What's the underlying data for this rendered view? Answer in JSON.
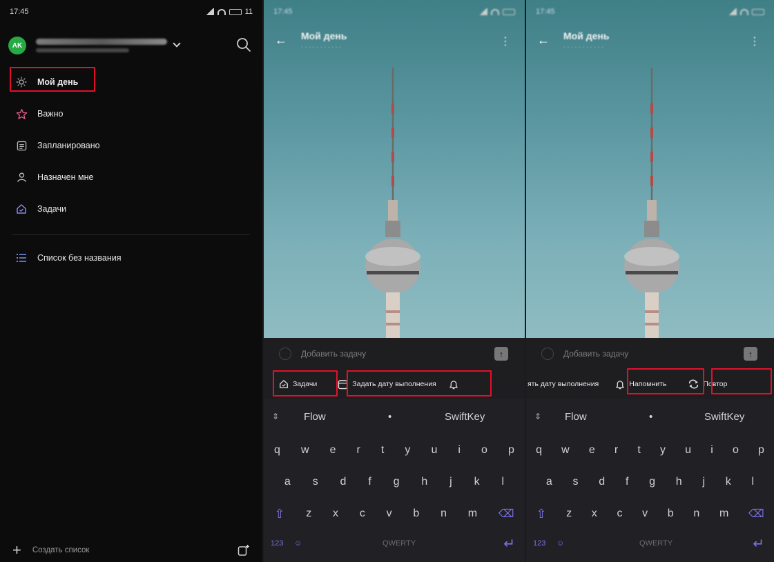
{
  "sidebar": {
    "status_time": "17:45",
    "status_battery": "11",
    "avatar_initials": "AK",
    "nav": [
      {
        "label": "Мой день",
        "icon": "sun-icon"
      },
      {
        "label": "Важно",
        "icon": "star-icon"
      },
      {
        "label": "Запланировано",
        "icon": "calendar-icon"
      },
      {
        "label": "Назначен мне",
        "icon": "person-icon"
      },
      {
        "label": "Задачи",
        "icon": "house-icon"
      }
    ],
    "list_label": "Список без названия",
    "create_list_label": "Создать список"
  },
  "compose": {
    "placeholder": "Добавить задачу"
  },
  "toolbar_mid": {
    "tasks_label": "Задачи",
    "due_label": "Задать дату выполнения"
  },
  "toolbar_right": {
    "due_partial_label": "ять дату выполнения",
    "remind_label": "Напомнить",
    "repeat_label": "Повтор"
  },
  "keyboard": {
    "suggest_left": "Flow",
    "suggest_mid": "•",
    "suggest_right": "SwiftKey",
    "row1": [
      "q",
      "w",
      "e",
      "r",
      "t",
      "y",
      "u",
      "i",
      "o",
      "p"
    ],
    "row2": [
      "a",
      "s",
      "d",
      "f",
      "g",
      "h",
      "j",
      "k",
      "l"
    ],
    "row3": [
      "z",
      "x",
      "c",
      "v",
      "b",
      "n",
      "m"
    ],
    "numbers_key": "123",
    "space_label": "QWERTY"
  },
  "colors": {
    "highlight": "#e3102a",
    "avatar": "#27a944",
    "accent": "#7b73e8"
  }
}
